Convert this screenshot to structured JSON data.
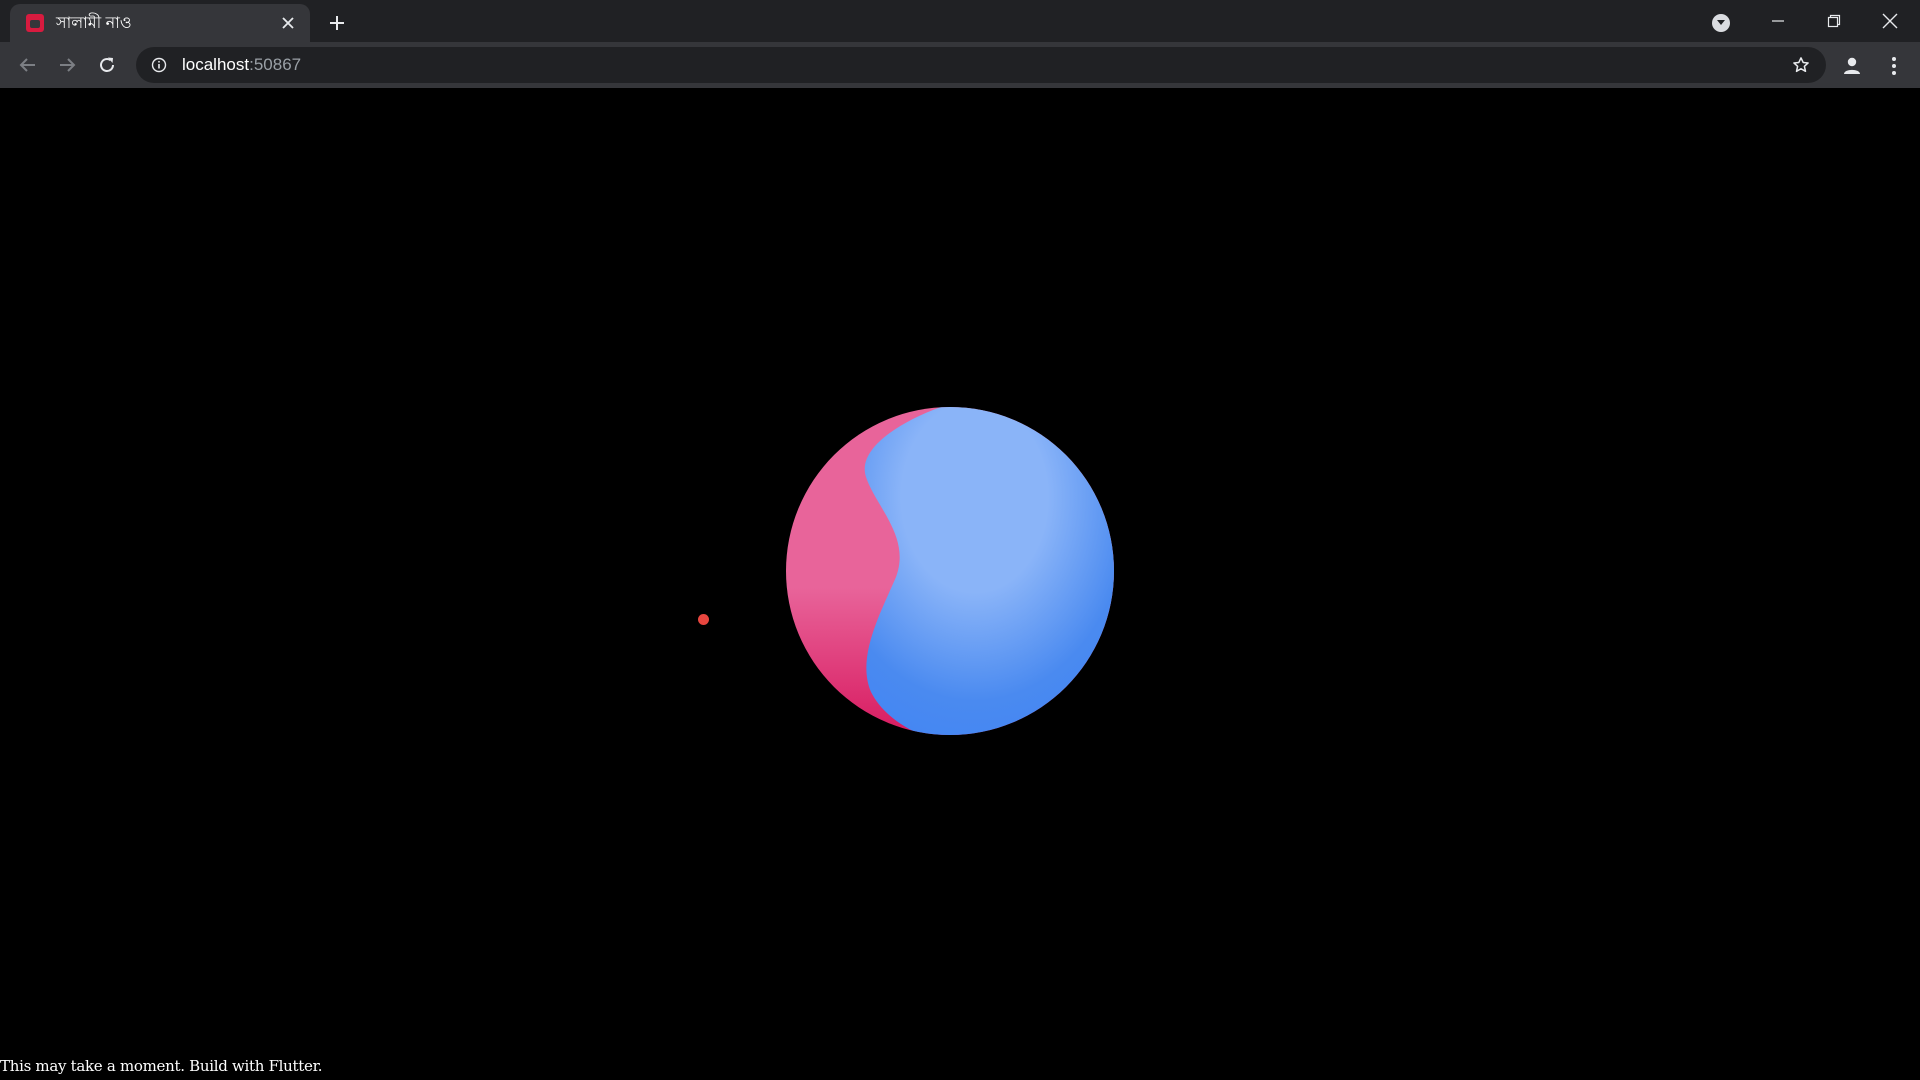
{
  "browser": {
    "tab": {
      "title": "সালামী নাও",
      "favicon": "app-favicon-icon"
    },
    "address_bar": {
      "host": "localhost",
      "port": ":50867",
      "info_icon": "info-icon"
    },
    "icons": {
      "back": "arrow-back-icon",
      "forward": "arrow-forward-icon",
      "reload": "reload-icon",
      "bookmark": "star-icon",
      "profile": "person-icon",
      "menu": "kebab-menu-icon",
      "new_tab": "plus-icon",
      "tab_close": "close-icon",
      "tab_search": "tab-search-icon",
      "minimize": "minimize-icon",
      "restore": "restore-icon",
      "window_close": "close-icon"
    },
    "colors": {
      "tabstrip": "#202124",
      "toolbar": "#35363a",
      "omnibox": "#202124"
    }
  },
  "page": {
    "background": "#000000",
    "loading_message": "This may take a moment. Build with Flutter.",
    "loader": {
      "pink_color": "#e8649a",
      "deep_pink_color": "#d81b60",
      "blue_color": "#4285f4",
      "light_blue_color": "#8ab4f8",
      "dot_color": "#e8463f"
    }
  }
}
